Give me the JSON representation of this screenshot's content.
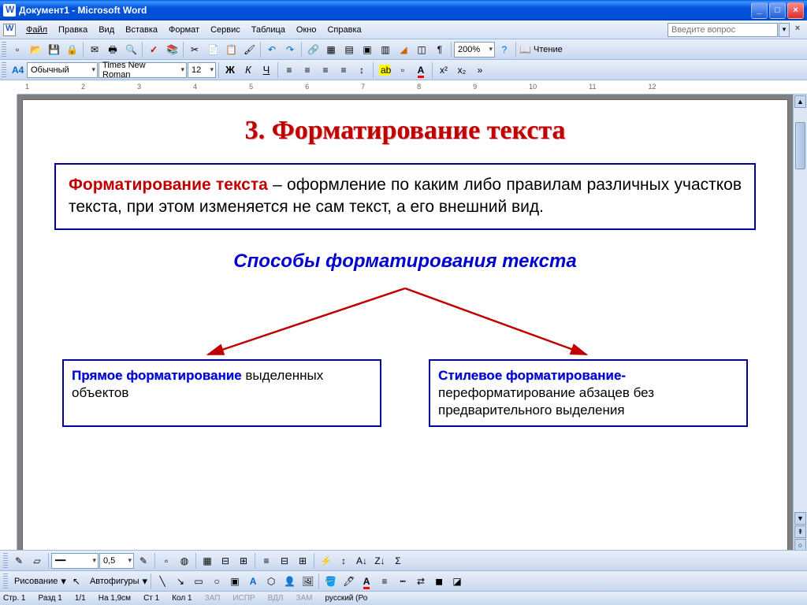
{
  "window": {
    "title": "Документ1 - Microsoft Word"
  },
  "menu": {
    "items": [
      "Файл",
      "Правка",
      "Вид",
      "Вставка",
      "Формат",
      "Сервис",
      "Таблица",
      "Окно",
      "Справка"
    ],
    "ask_placeholder": "Введите вопрос"
  },
  "toolbar1": {
    "zoom": "200%",
    "reading": "Чтение"
  },
  "toolbar2": {
    "style_indicator": "A4",
    "style": "Обычный",
    "font": "Times New Roman",
    "size": "12",
    "bold": "Ж",
    "italic": "К",
    "underline": "Ч"
  },
  "ruler": {
    "marks": [
      "",
      "1",
      "2",
      "3",
      "4",
      "5",
      "6",
      "7",
      "8",
      "9",
      "10",
      "11",
      "12"
    ]
  },
  "document": {
    "heading": "3. Форматирование текста",
    "def_term": "Форматирование текста",
    "def_rest": " – оформление по каким либо правилам различных участков текста, при этом изменяется не сам текст, а его внешний вид.",
    "subheading": "Способы форматирования текста",
    "left_term": "Прямое  форматирование",
    "left_rest": " выделенных объектов",
    "right_term": "Стилевое форматирование-",
    "right_rest": "переформатирование абзацев без предварительного выделения"
  },
  "bottom": {
    "line_weight": "0,5",
    "draw_label": "Рисование",
    "autoshapes": "Автофигуры"
  },
  "status": {
    "page": "Стр. 1",
    "section": "Разд 1",
    "pages": "1/1",
    "at": "На 1,9см",
    "line": "Ст 1",
    "col": "Кол 1",
    "rec": "ЗАП",
    "trk": "ИСПР",
    "ext": "ВДЛ",
    "ovr": "ЗАМ",
    "lang": "русский (Ро"
  }
}
